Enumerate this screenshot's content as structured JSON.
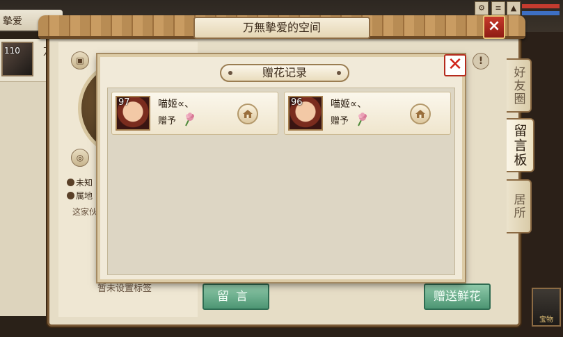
{
  "window": {
    "title": "万無摰爱的空间",
    "left_tab_label": "摰爱",
    "close_icon": "×"
  },
  "profile": {
    "level": "110",
    "name_partial": "万",
    "location_unknown": "未知",
    "location_label": "属地",
    "home_desc": "这家伙",
    "tag_text": "暂未设置标签"
  },
  "side_tabs": [
    {
      "label": "好友圈",
      "active": false
    },
    {
      "label": "留言板",
      "active": true
    },
    {
      "label": "居所",
      "active": false
    }
  ],
  "buttons": {
    "message": "留言",
    "send_flowers": "赠送鲜花"
  },
  "corner_thumb_label": "宝物",
  "modal": {
    "title": "赠花记录",
    "close_icon": "✕",
    "records": [
      {
        "level": "97",
        "name": "喵姬∝、",
        "action": "赠予",
        "item_icon": "flower-icon",
        "home_icon": "house-icon"
      },
      {
        "level": "96",
        "name": "喵姬∝、",
        "action": "赠予",
        "item_icon": "flower-icon",
        "home_icon": "house-icon"
      }
    ]
  },
  "colors": {
    "close_red": "#d0241a",
    "button_green": "#4c9573",
    "panel_cream": "#f1ead9"
  }
}
